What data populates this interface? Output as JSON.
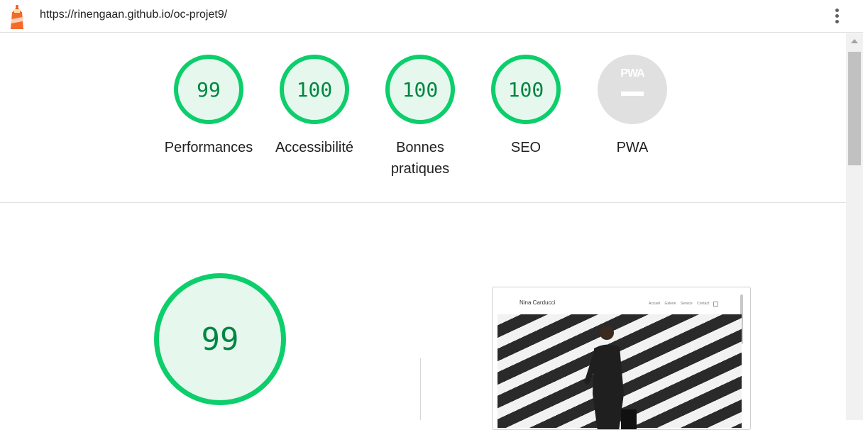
{
  "browser": {
    "url": "https://rinengaan.github.io/oc-projet9/",
    "logo_icon": "lighthouse-icon",
    "menu_icon": "kebab-menu-icon"
  },
  "gauges": [
    {
      "score": "99",
      "label": "Performances"
    },
    {
      "score": "100",
      "label": "Accessibilité"
    },
    {
      "score": "100",
      "label": "Bonnes pratiques"
    },
    {
      "score": "100",
      "label": "SEO"
    }
  ],
  "pwa": {
    "badge_text": "PWA",
    "label": "PWA"
  },
  "performance": {
    "score": "99"
  },
  "screenshot": {
    "site_name": "Nina Carducci",
    "nav": [
      "Accueil",
      "Galerie",
      "Service",
      "Contact"
    ]
  },
  "colors": {
    "pass": "#0cce6b",
    "pass_bg": "#e6f8ee",
    "pass_text": "#018642",
    "na": "#e0e0e0"
  }
}
